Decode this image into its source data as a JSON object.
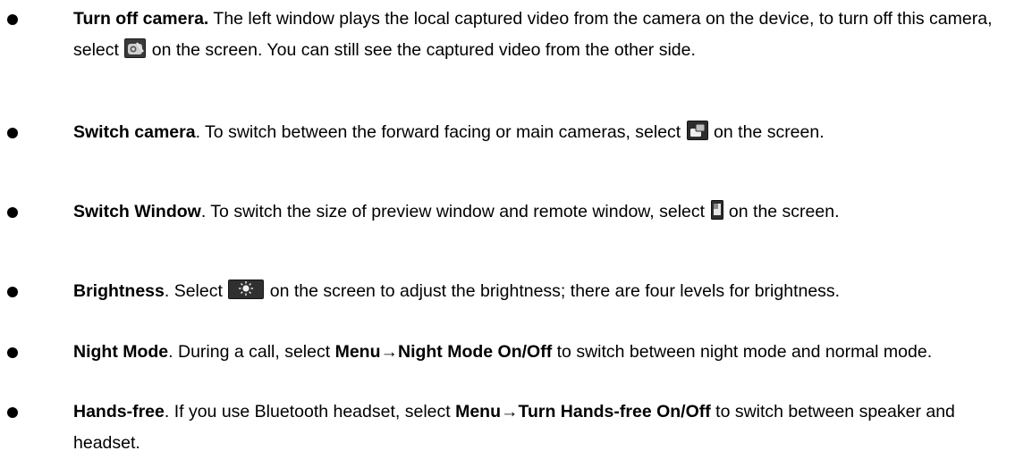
{
  "items": [
    {
      "title": "Turn off camera.",
      "text1": " The left window plays the local captured video from the camera on the device, to turn off this camera, select ",
      "icon": "camera-off-icon",
      "text2": " on the screen. You can still see the captured video from the other side."
    },
    {
      "title": "Switch camera",
      "text1": ". To switch between the forward facing or main cameras, select ",
      "icon": "switch-camera-icon",
      "text2": " on the screen."
    },
    {
      "title": "Switch Window",
      "text1": ". To switch the size of preview window and remote window, select ",
      "icon": "switch-window-icon",
      "text2": " on the screen."
    },
    {
      "title": "Brightness",
      "text1": ". Select ",
      "icon": "brightness-icon",
      "text2": " on the screen to adjust the brightness; there are four levels for brightness."
    },
    {
      "title": "Night Mode",
      "text1": ". During a call, select ",
      "bold_mid": "Menu→Night Mode On/Off",
      "text2": " to switch between night mode and normal mode."
    },
    {
      "title": "Hands-free",
      "text1": ". If you use Bluetooth headset, select ",
      "bold_mid": "Menu→Turn Hands-free On/Off",
      "text2": " to switch between speaker and headset."
    }
  ]
}
